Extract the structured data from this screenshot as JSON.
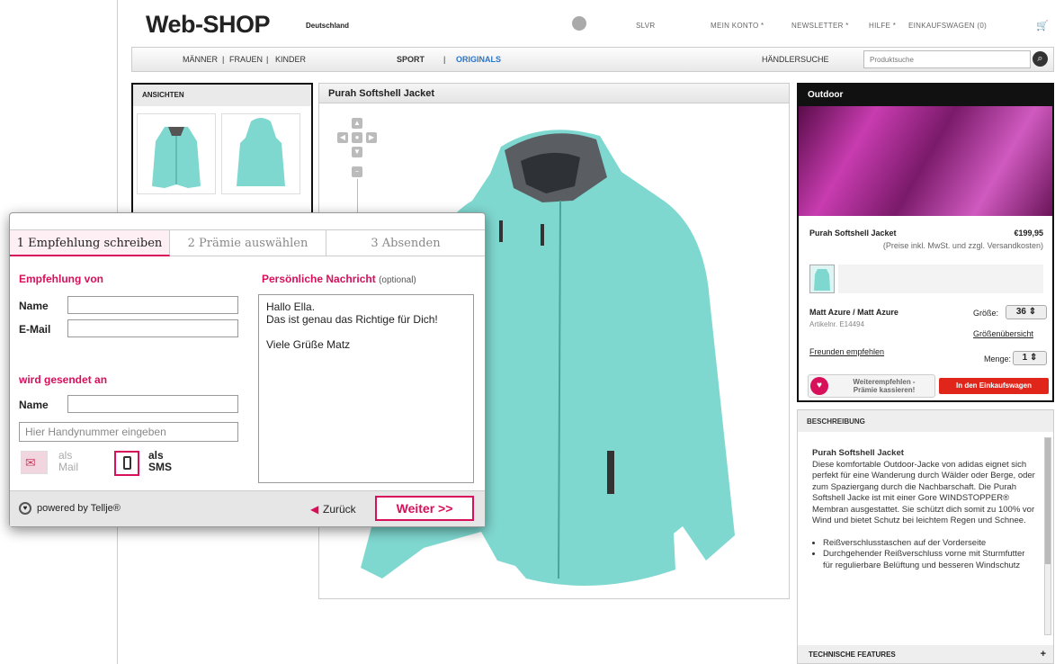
{
  "shop": {
    "logo": "Web-SHOP",
    "country": "Deutschland",
    "top_links": [
      "SLVR",
      "MEIN KONTO *",
      "NEWSLETTER *",
      "HILFE *",
      "EINKAUFSWAGEN (0)"
    ],
    "nav": {
      "genders": [
        "MÄNNER",
        "|",
        "FRAUEN",
        "|",
        "KINDER"
      ],
      "sport": "SPORT",
      "sep": "|",
      "originals": "ORIGINALS",
      "dealer": "HÄNDLERSUCHE",
      "search_placeholder": "Produktsuche"
    }
  },
  "views": {
    "title": "ANSICHTEN"
  },
  "product": {
    "name": "Purah Softshell Jacket",
    "category": "Outdoor",
    "price": "€199,95",
    "price_note": "(Preise inkl. MwSt. und zzgl. Versandkosten)",
    "color": "Matt Azure / Matt Azure",
    "article": "Artikelnr. E14494",
    "size_label": "Größe:",
    "size_value": "36",
    "size_chart": "Größenübersicht",
    "recommend_link": "Freunden empfehlen",
    "qty_label": "Menge:",
    "qty_value": "1",
    "recommend_btn": [
      "Weiterempfehlen -",
      "Prämie kassieren!"
    ],
    "cart_btn": "In den Einkaufswagen"
  },
  "description": {
    "title": "BESCHREIBUNG",
    "heading": "Purah Softshell Jacket",
    "text": "Diese komfortable Outdoor-Jacke von adidas eignet sich perfekt für eine Wanderung durch Wälder oder Berge, oder zum Spaziergang durch die Nachbarschaft. Die Purah Softshell Jacke ist mit einer Gore WINDSTOPPER® Membran ausgestattet. Sie schützt dich somit zu 100% vor Wind und bietet Schutz bei leichtem Regen und Schnee.",
    "bullets": [
      "Reißverschlusstaschen auf der Vorderseite",
      "Durchgehender Reißverschluss vorne mit Sturmfutter für regulierbare Belüftung und besseren Windschutz"
    ],
    "tech_features": "TECHNISCHE FEATURES",
    "plus": "+"
  },
  "popup": {
    "tabs": [
      "1 Empfehlung schreiben",
      "2 Prämie auswählen",
      "3 Absenden"
    ],
    "from_title": "Empfehlung von",
    "name_label": "Name",
    "email_label": "E-Mail",
    "to_title": "wird gesendet an",
    "to_name_label": "Name",
    "phone_placeholder": "Hier Handynummer eingeben",
    "as_mail": [
      "als",
      "Mail"
    ],
    "as_sms": [
      "als",
      "SMS"
    ],
    "message_title": "Persönliche Nachricht",
    "message_optional": "(optional)",
    "message": "Hallo Ella.\nDas ist genau das Richtige für Dich!\n\nViele Grüße Matz",
    "powered": "powered by Tellje®",
    "back": "Zurück",
    "next": "Weiter >>"
  },
  "colors": {
    "accent": "#d80f5a",
    "jacket": "#7fd8d0",
    "cart_red": "#e0261b"
  }
}
